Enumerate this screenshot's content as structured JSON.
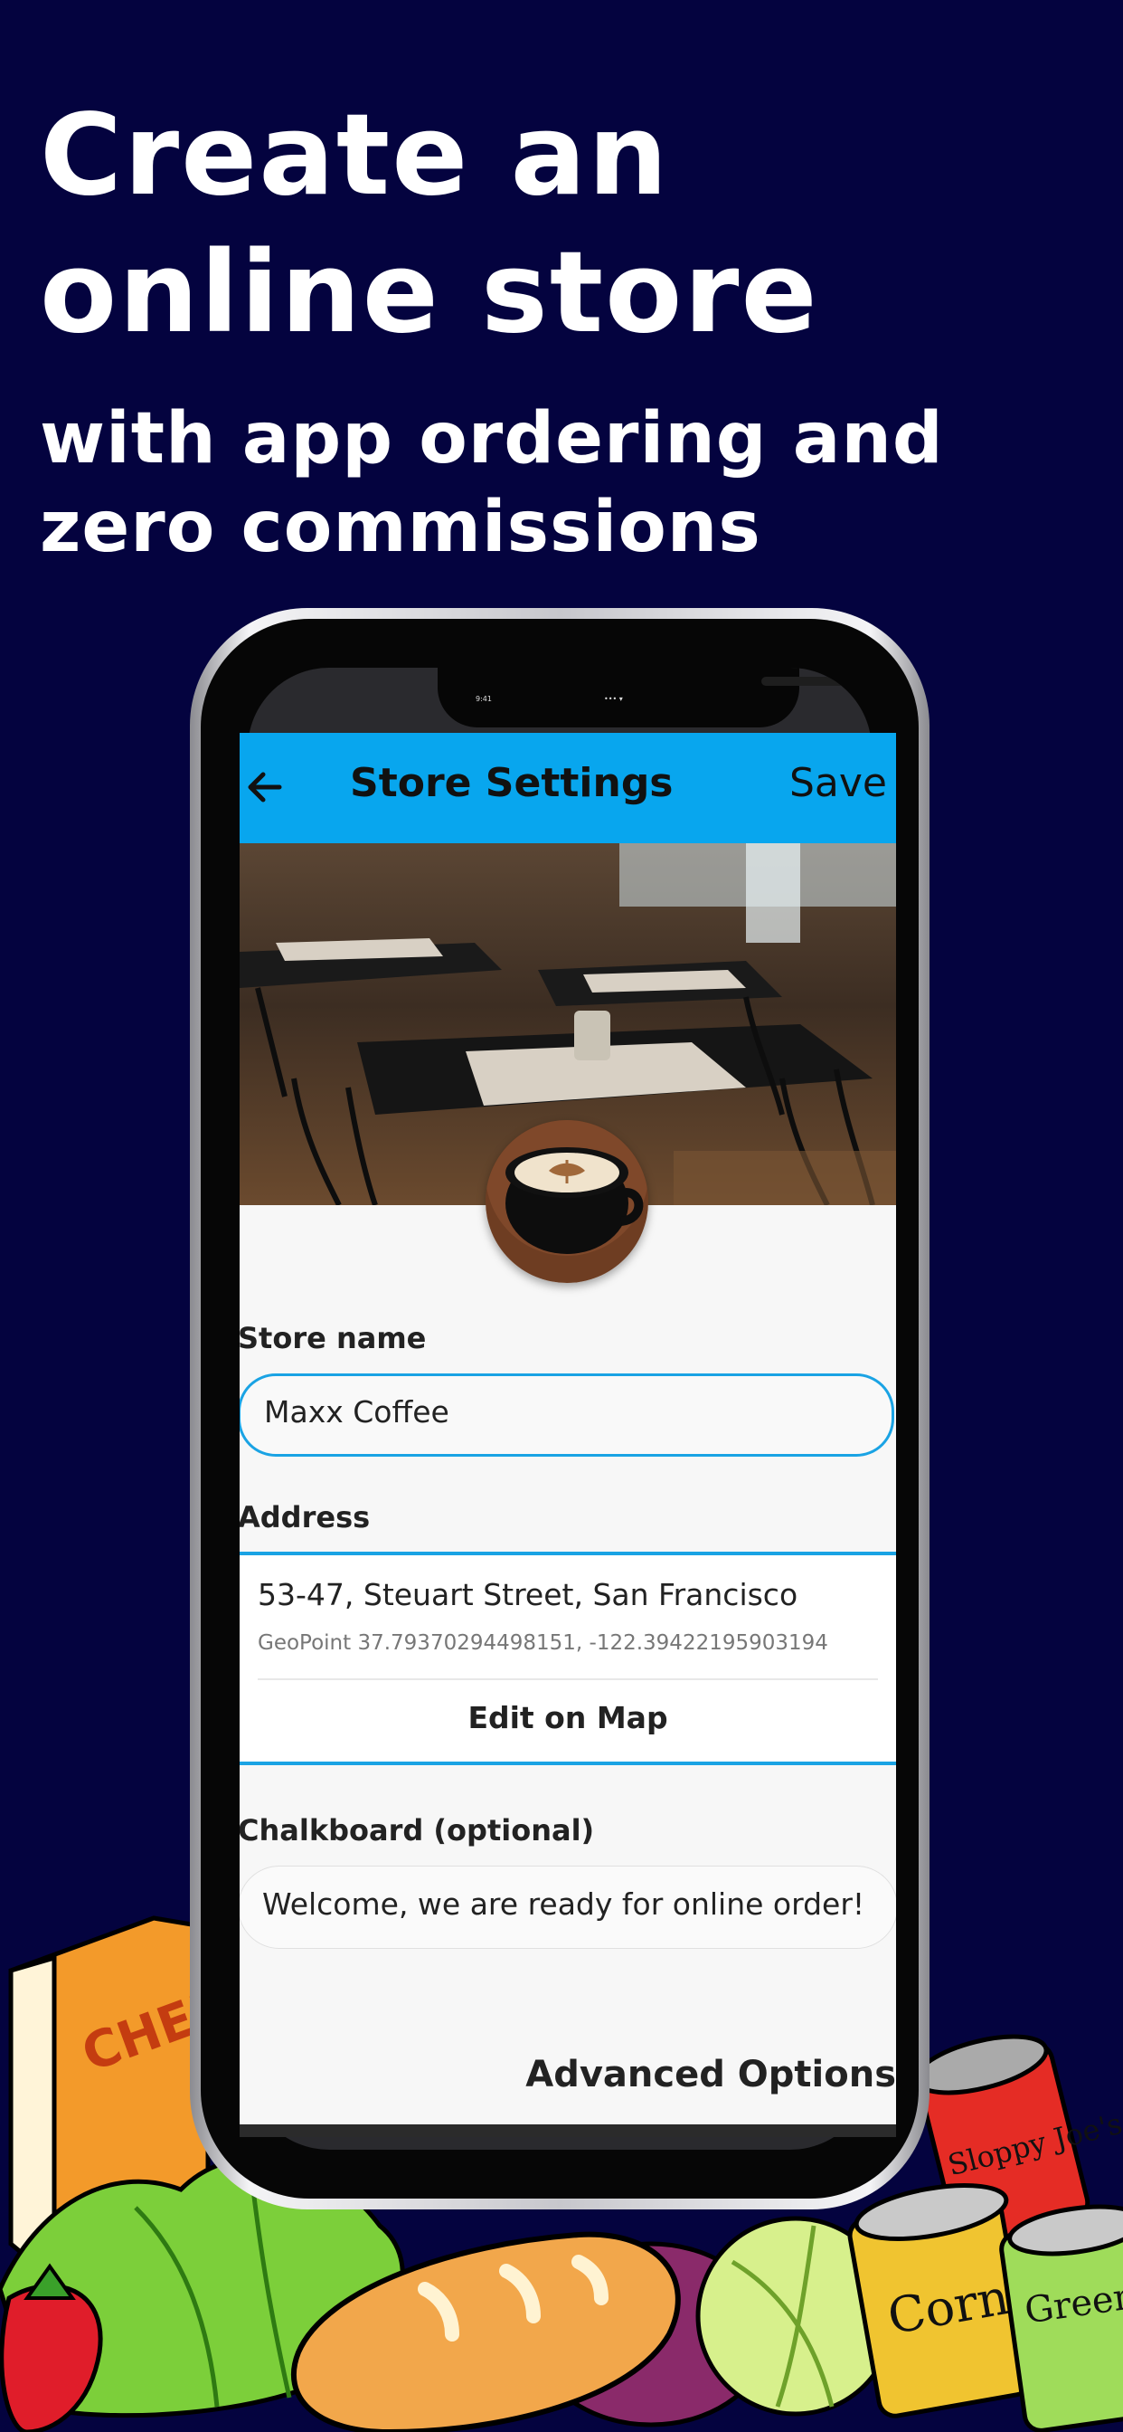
{
  "headline": {
    "line1": "Create an",
    "line2": "online store",
    "line3": "with app ordering and",
    "line4": "zero commissions"
  },
  "status_bar": {
    "time": "9:41",
    "signal": "••• ▾"
  },
  "appbar": {
    "back_icon": "arrow-left-icon",
    "title": "Store Settings",
    "save_label": "Save",
    "color": "#08a6ee"
  },
  "form": {
    "store_name_label": "Store name",
    "store_name_value": "Maxx Coffee",
    "address_label": "Address",
    "address_value": "53-47, Steuart Street, San Francisco",
    "geopoint": "GeoPoint 37.79370294498151, -122.39422195903194",
    "edit_map_label": "Edit on Map",
    "chalkboard_label": "Chalkboard (optional)",
    "chalkboard_value": "Welcome, we are ready for online order!",
    "advanced_label": "Advanced Options"
  },
  "illustration_text": {
    "can_left_label": "Sloppy Joe's",
    "corn_label": "Corn",
    "beans_label": "Green Beans",
    "box_label": "CHEE"
  },
  "colors": {
    "background": "#04033f",
    "accent": "#1aa3e4"
  }
}
